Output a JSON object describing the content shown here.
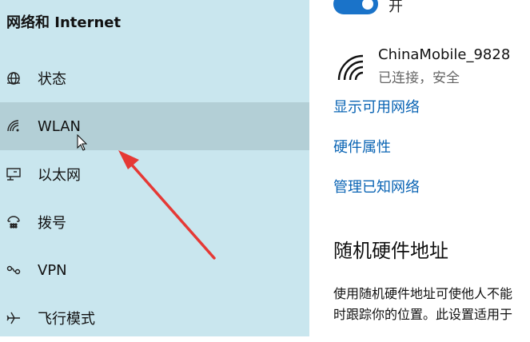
{
  "sidebar": {
    "title": "网络和 Internet",
    "items": [
      {
        "label": "状态",
        "icon": "globe-icon"
      },
      {
        "label": "WLAN",
        "icon": "wifi-icon",
        "selected": true
      },
      {
        "label": "以太网",
        "icon": "ethernet-icon"
      },
      {
        "label": "拨号",
        "icon": "dialup-icon"
      },
      {
        "label": "VPN",
        "icon": "vpn-icon"
      },
      {
        "label": "飞行模式",
        "icon": "airplane-icon"
      }
    ]
  },
  "main": {
    "toggle_label": "开",
    "toggle_on": true,
    "network": {
      "name": "ChinaMobile_9828",
      "status": "已连接，安全"
    },
    "links": [
      "显示可用网络",
      "硬件属性",
      "管理已知网络"
    ],
    "random_hw": {
      "heading": "随机硬件地址",
      "desc_line1": "使用随机硬件地址可使他人不能",
      "desc_line2": "时跟踪你的位置。此设置适用于"
    }
  },
  "colors": {
    "sidebar_bg": "#c9e6ee",
    "selected_bg": "#b3cfd6",
    "accent": "#1a73c9",
    "link": "#0a64b4",
    "annotation": "#e53935"
  }
}
